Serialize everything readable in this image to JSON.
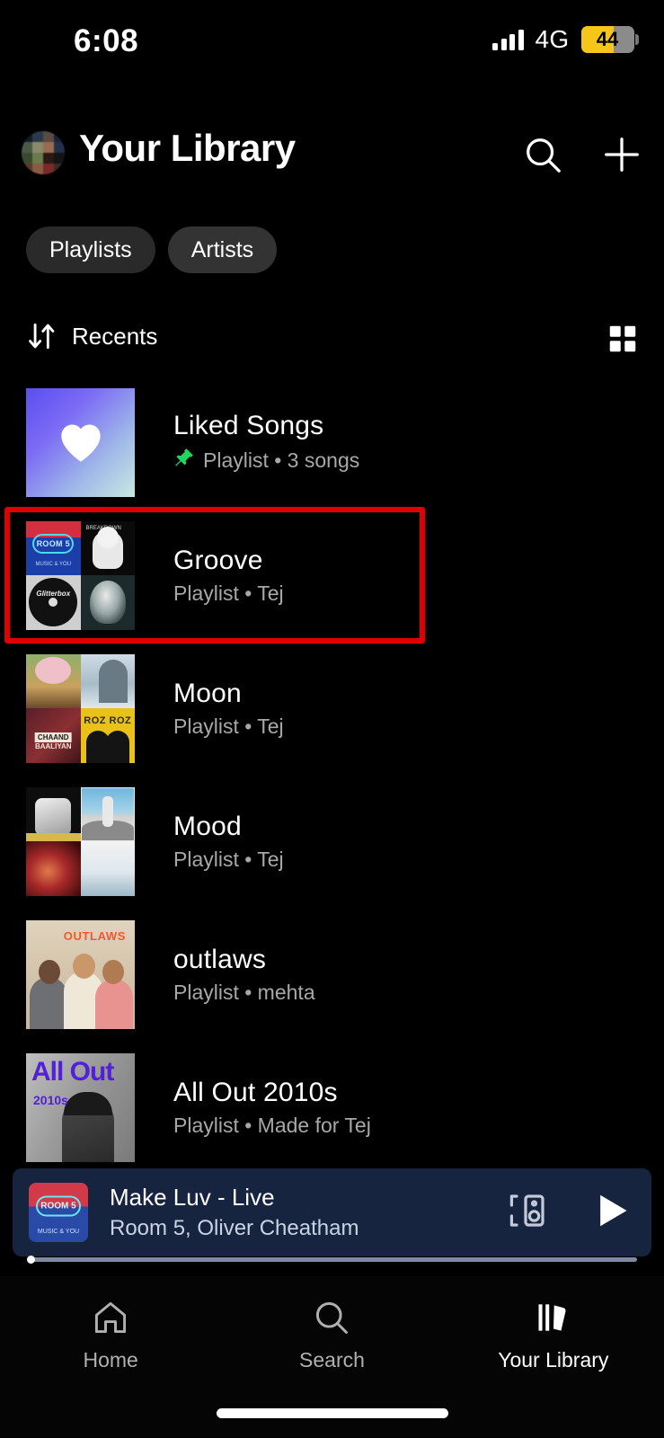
{
  "status_bar": {
    "time": "6:08",
    "network": "4G",
    "battery_percent": "44",
    "signal_icon": "signal-bars-icon",
    "battery_icon": "battery-icon"
  },
  "header": {
    "title": "Your Library",
    "avatar_name": "profile-avatar",
    "search_icon": "search-icon",
    "add_icon": "plus-icon"
  },
  "filters": [
    {
      "label": "Playlists",
      "selected": true
    },
    {
      "label": "Artists",
      "selected": false
    }
  ],
  "sort": {
    "label": "Recents",
    "sort_icon": "sort-arrows-icon",
    "view_toggle_icon": "grid-view-icon"
  },
  "library_items": [
    {
      "title": "Liked Songs",
      "subtitle": "Playlist • 3 songs",
      "type": "Playlist",
      "detail": "3 songs",
      "pinned": true,
      "thumb": "liked-songs-gradient"
    },
    {
      "title": "Groove",
      "subtitle": "Playlist • Tej",
      "type": "Playlist",
      "detail": "Tej",
      "pinned": false,
      "thumb": "groove-mosaic",
      "highlighted": true
    },
    {
      "title": "Moon",
      "subtitle": "Playlist • Tej",
      "type": "Playlist",
      "detail": "Tej",
      "pinned": false,
      "thumb": "moon-mosaic"
    },
    {
      "title": "Mood",
      "subtitle": "Playlist • Tej",
      "type": "Playlist",
      "detail": "Tej",
      "pinned": false,
      "thumb": "mood-mosaic"
    },
    {
      "title": "outlaws",
      "subtitle": "Playlist • mehta",
      "type": "Playlist",
      "detail": "mehta",
      "pinned": false,
      "thumb": "outlaws-cover"
    },
    {
      "title": "All Out 2010s",
      "subtitle": "Playlist • Made for Tej",
      "type": "Playlist",
      "detail": "Made for Tej",
      "pinned": false,
      "thumb": "all-out-2010s-cover"
    }
  ],
  "artwork_text": {
    "room5_title": "ROOM 5",
    "room5_sub": "MUSIC & YOU",
    "breakdown_title": "BREAKDOWN",
    "glitterbox_title": "Glitterbox",
    "roz_roz": "ROZ ROZ",
    "chaand": "CHAAND",
    "baaliyan": "BAALIYAN",
    "outlaws": "OUTLAWS",
    "all_out": "All Out",
    "all_out_year": "2010s"
  },
  "now_playing": {
    "track": "Make Luv - Live",
    "artists": "Room 5, Oliver Cheatham",
    "art_name": "room5-album-art",
    "connect_icon": "connect-to-device-icon",
    "play_icon": "play-icon",
    "progress_percent": 1
  },
  "bottom_nav": [
    {
      "label": "Home",
      "icon": "home-icon",
      "active": false
    },
    {
      "label": "Search",
      "icon": "search-icon",
      "active": false
    },
    {
      "label": "Your Library",
      "icon": "library-icon",
      "active": true
    }
  ],
  "colors": {
    "background": "#000000",
    "accent_green": "#1ed760",
    "highlight_red": "#e00000",
    "now_playing_bg": "#16243f",
    "battery_yellow": "#f5c518",
    "text_secondary": "#a8a8a8"
  }
}
